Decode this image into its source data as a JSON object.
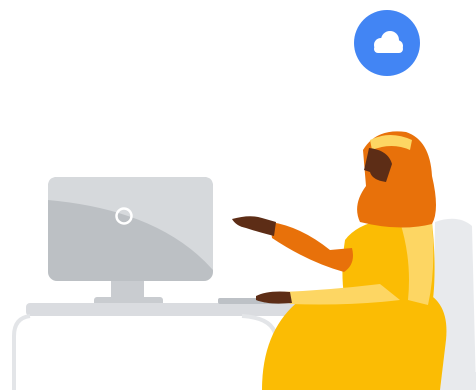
{
  "illustration": {
    "icons": {
      "badge": "cloud-icon",
      "monitor_logo": "ring-logo-icon"
    },
    "colors": {
      "cloud_badge": "#4285f4",
      "cloud_glyph": "#ffffff",
      "monitor_body": "#bcc0c4",
      "monitor_shade": "#d6d9dc",
      "monitor_stand": "#c9ccd0",
      "desk": "#dadce0",
      "hijab": "#e8710a",
      "hijab_dark": "#d65f00",
      "skin": "#5d2d16",
      "blouse": "#fbbc04",
      "blouse_light": "#fdd663",
      "chair": "#e8eaed"
    }
  }
}
